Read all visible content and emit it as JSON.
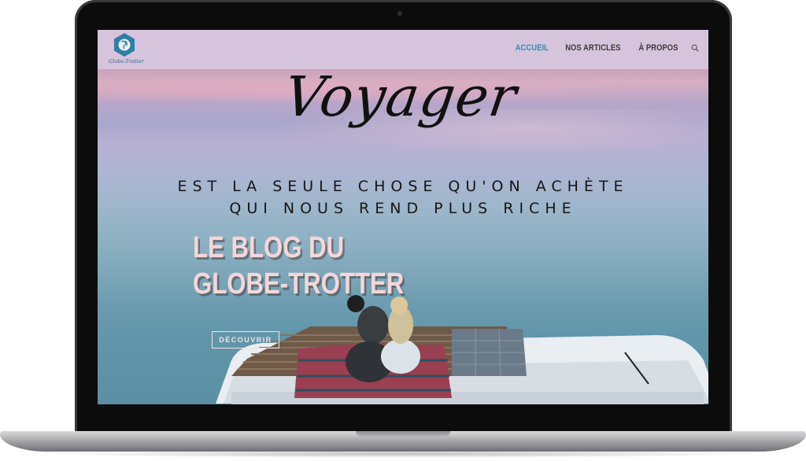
{
  "header": {
    "logo_text": "Globe-Trotter",
    "nav": [
      {
        "label": "ACCUEIL",
        "active": true
      },
      {
        "label": "NOS ARTICLES",
        "active": false
      },
      {
        "label": "À PROPOS",
        "active": false
      }
    ],
    "search_icon": "search-icon"
  },
  "hero": {
    "script_title": "Voyager",
    "tagline_line1": "EST LA SEULE CHOSE QU'ON ACHÈTE",
    "tagline_line2": "QUI NOUS REND PLUS RICHE",
    "blog_title": "LE BLOG DU GLOBE-TROTTER",
    "cta_label": "DÉCOUVRIR"
  },
  "colors": {
    "header_bg": "#d6c3dc",
    "nav_active": "#2f8fb0",
    "nav_default": "#3a3a3a",
    "blog_title": "#f6d6d8",
    "logo_hex": "#2e7fa8"
  }
}
